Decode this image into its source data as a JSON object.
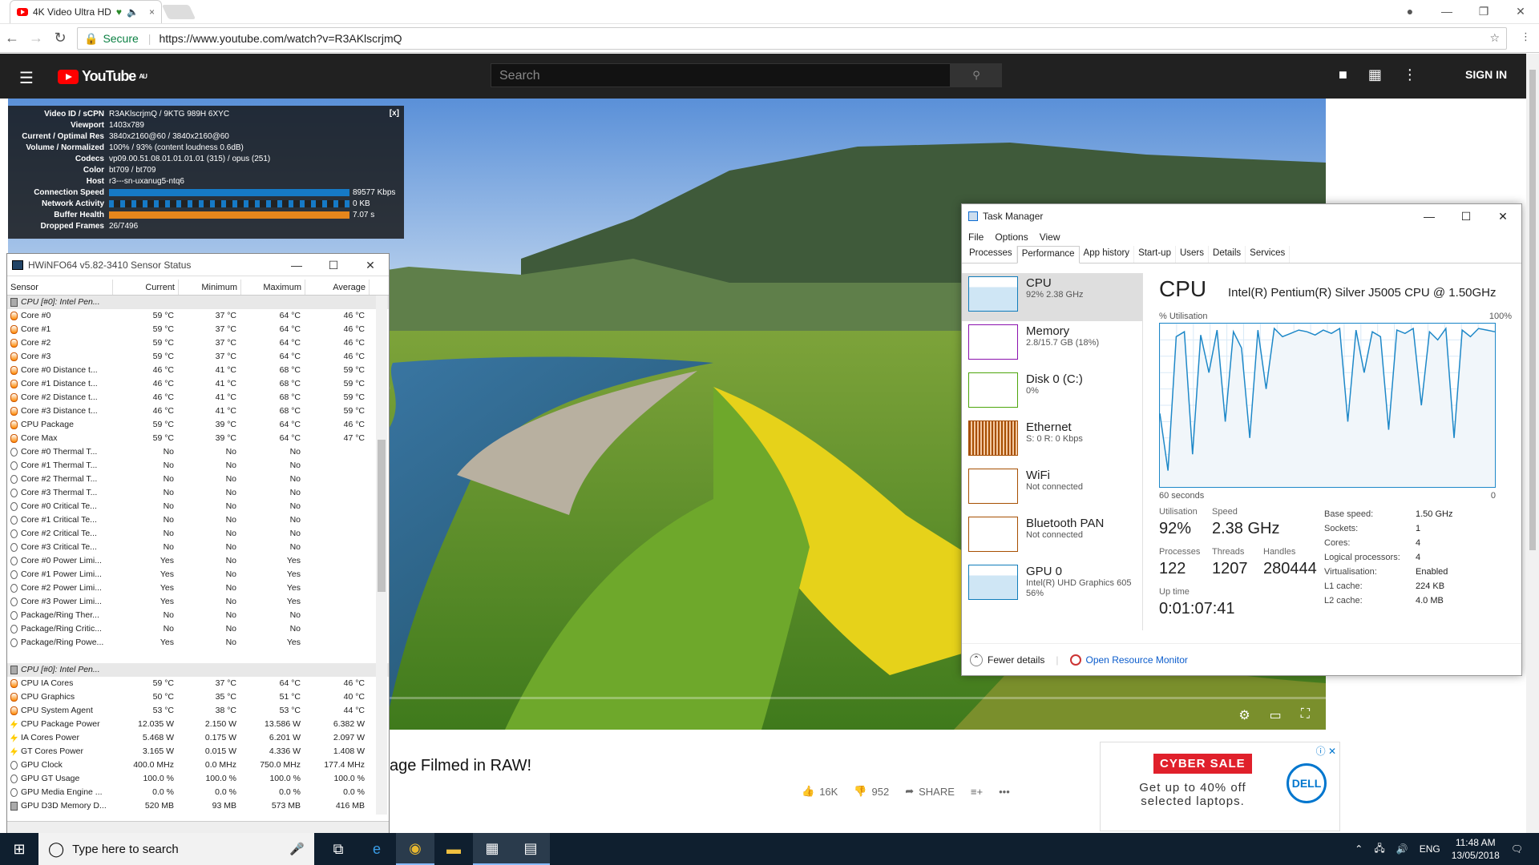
{
  "browser": {
    "tab_title": "4K Video Ultra HD",
    "secure_label": "Secure",
    "url": "https://www.youtube.com/watch?v=R3AKlscrjmQ"
  },
  "youtube": {
    "logo_text": "YouTube",
    "region": "AU",
    "search_placeholder": "Search",
    "signin": "SIGN IN",
    "title_fragment": "age Filmed in RAW!",
    "likes": "16K",
    "dislikes": "952",
    "share": "SHARE"
  },
  "stats": {
    "close": "[x]",
    "rows": [
      {
        "k": "Video ID / sCPN",
        "v": "R3AKlscrjmQ / 9KTG 989H 6XYC"
      },
      {
        "k": "Viewport",
        "v": "1403x789"
      },
      {
        "k": "Current / Optimal Res",
        "v": "3840x2160@60 / 3840x2160@60"
      },
      {
        "k": "Volume / Normalized",
        "v": "100% / 93% (content loudness 0.6dB)"
      },
      {
        "k": "Codecs",
        "v": "vp09.00.51.08.01.01.01.01 (315) / opus (251)"
      },
      {
        "k": "Color",
        "v": "bt709 / bt709"
      },
      {
        "k": "Host",
        "v": "r3---sn-uxanug5-ntq6"
      }
    ],
    "bars": [
      {
        "k": "Connection Speed",
        "v": "89577 Kbps",
        "cls": "bar1"
      },
      {
        "k": "Network Activity",
        "v": "0 KB",
        "cls": "bar2"
      },
      {
        "k": "Buffer Health",
        "v": "7.07 s",
        "cls": "bar3"
      }
    ],
    "dropped": {
      "k": "Dropped Frames",
      "v": "26/7496"
    }
  },
  "ad": {
    "headline": "CYBER SALE",
    "body": "Get up to 40% off selected laptops.",
    "brand": "DELL"
  },
  "hwinfo": {
    "title": "HWiNFO64 v5.82-3410 Sensor Status",
    "headers": [
      "Sensor",
      "Current",
      "Minimum",
      "Maximum",
      "Average"
    ],
    "rows": [
      [
        "grp",
        "CPU [#0]: Intel Pen...",
        "",
        "",
        "",
        ""
      ],
      [
        "th",
        "Core #0",
        "59 °C",
        "37 °C",
        "64 °C",
        "46 °C"
      ],
      [
        "th",
        "Core #1",
        "59 °C",
        "37 °C",
        "64 °C",
        "46 °C"
      ],
      [
        "th",
        "Core #2",
        "59 °C",
        "37 °C",
        "64 °C",
        "46 °C"
      ],
      [
        "th",
        "Core #3",
        "59 °C",
        "37 °C",
        "64 °C",
        "46 °C"
      ],
      [
        "th",
        "Core #0 Distance t...",
        "46 °C",
        "41 °C",
        "68 °C",
        "59 °C"
      ],
      [
        "th",
        "Core #1 Distance t...",
        "46 °C",
        "41 °C",
        "68 °C",
        "59 °C"
      ],
      [
        "th",
        "Core #2 Distance t...",
        "46 °C",
        "41 °C",
        "68 °C",
        "59 °C"
      ],
      [
        "th",
        "Core #3 Distance t...",
        "46 °C",
        "41 °C",
        "68 °C",
        "59 °C"
      ],
      [
        "th",
        "CPU Package",
        "59 °C",
        "39 °C",
        "64 °C",
        "46 °C"
      ],
      [
        "th",
        "Core Max",
        "59 °C",
        "39 °C",
        "64 °C",
        "47 °C"
      ],
      [
        "ck",
        "Core #0 Thermal T...",
        "No",
        "No",
        "No",
        ""
      ],
      [
        "ck",
        "Core #1 Thermal T...",
        "No",
        "No",
        "No",
        ""
      ],
      [
        "ck",
        "Core #2 Thermal T...",
        "No",
        "No",
        "No",
        ""
      ],
      [
        "ck",
        "Core #3 Thermal T...",
        "No",
        "No",
        "No",
        ""
      ],
      [
        "ck",
        "Core #0 Critical Te...",
        "No",
        "No",
        "No",
        ""
      ],
      [
        "ck",
        "Core #1 Critical Te...",
        "No",
        "No",
        "No",
        ""
      ],
      [
        "ck",
        "Core #2 Critical Te...",
        "No",
        "No",
        "No",
        ""
      ],
      [
        "ck",
        "Core #3 Critical Te...",
        "No",
        "No",
        "No",
        ""
      ],
      [
        "ck",
        "Core #0 Power Limi...",
        "Yes",
        "No",
        "Yes",
        ""
      ],
      [
        "ck",
        "Core #1 Power Limi...",
        "Yes",
        "No",
        "Yes",
        ""
      ],
      [
        "ck",
        "Core #2 Power Limi...",
        "Yes",
        "No",
        "Yes",
        ""
      ],
      [
        "ck",
        "Core #3 Power Limi...",
        "Yes",
        "No",
        "Yes",
        ""
      ],
      [
        "ck",
        "Package/Ring Ther...",
        "No",
        "No",
        "No",
        ""
      ],
      [
        "ck",
        "Package/Ring Critic...",
        "No",
        "No",
        "No",
        ""
      ],
      [
        "ck",
        "Package/Ring Powe...",
        "Yes",
        "No",
        "Yes",
        ""
      ],
      [
        "blank",
        "",
        "",
        "",
        "",
        ""
      ],
      [
        "grp",
        "CPU [#0]: Intel Pen...",
        "",
        "",
        "",
        ""
      ],
      [
        "th",
        "CPU IA Cores",
        "59 °C",
        "37 °C",
        "64 °C",
        "46 °C"
      ],
      [
        "th",
        "CPU Graphics",
        "50 °C",
        "35 °C",
        "51 °C",
        "40 °C"
      ],
      [
        "th",
        "CPU System Agent",
        "53 °C",
        "38 °C",
        "53 °C",
        "44 °C"
      ],
      [
        "pw",
        "CPU Package Power",
        "12.035 W",
        "2.150 W",
        "13.586 W",
        "6.382 W"
      ],
      [
        "pw",
        "IA Cores Power",
        "5.468 W",
        "0.175 W",
        "6.201 W",
        "2.097 W"
      ],
      [
        "pw",
        "GT Cores Power",
        "3.165 W",
        "0.015 W",
        "4.336 W",
        "1.408 W"
      ],
      [
        "ck",
        "GPU Clock",
        "400.0 MHz",
        "0.0 MHz",
        "750.0 MHz",
        "177.4 MHz"
      ],
      [
        "ck",
        "GPU GT Usage",
        "100.0 %",
        "100.0 %",
        "100.0 %",
        "100.0 %"
      ],
      [
        "ck",
        "GPU Media Engine ...",
        "0.0 %",
        "0.0 %",
        "0.0 %",
        "0.0 %"
      ],
      [
        "gp",
        "GPU D3D Memory D...",
        "520 MB",
        "93 MB",
        "573 MB",
        "416 MB"
      ]
    ]
  },
  "taskmgr": {
    "title": "Task Manager",
    "menu": [
      "File",
      "Options",
      "View"
    ],
    "tabs": [
      "Processes",
      "Performance",
      "App history",
      "Start-up",
      "Users",
      "Details",
      "Services"
    ],
    "resources": [
      {
        "name": "CPU",
        "sub1": "92% 2.38 GHz",
        "sub2": "",
        "color": "#117dbb"
      },
      {
        "name": "Memory",
        "sub1": "2.8/15.7 GB (18%)",
        "sub2": "",
        "color": "#8b12ae"
      },
      {
        "name": "Disk 0 (C:)",
        "sub1": "0%",
        "sub2": "",
        "color": "#4da60c"
      },
      {
        "name": "Ethernet",
        "sub1": "S: 0 R: 0 Kbps",
        "sub2": "",
        "color": "#a74f01"
      },
      {
        "name": "WiFi",
        "sub1": "Not connected",
        "sub2": "",
        "color": "#a74f01"
      },
      {
        "name": "Bluetooth PAN",
        "sub1": "Not connected",
        "sub2": "",
        "color": "#a74f01"
      },
      {
        "name": "GPU 0",
        "sub1": "Intel(R) UHD Graphics 605",
        "sub2": "56%",
        "color": "#117dbb"
      }
    ],
    "heading": "CPU",
    "cpu_name": "Intel(R) Pentium(R) Silver J5005 CPU @ 1.50GHz",
    "util_label": "% Utilisation",
    "pct100": "100%",
    "sixty": "60 seconds",
    "zero": "0",
    "utilisation_label": "Utilisation",
    "utilisation": "92%",
    "speed_label": "Speed",
    "speed": "2.38 GHz",
    "processes_label": "Processes",
    "processes": "122",
    "threads_label": "Threads",
    "threads": "1207",
    "handles_label": "Handles",
    "handles": "280444",
    "uptime_label": "Up time",
    "uptime": "0:01:07:41",
    "specs": [
      {
        "k": "Base speed:",
        "v": "1.50 GHz"
      },
      {
        "k": "Sockets:",
        "v": "1"
      },
      {
        "k": "Cores:",
        "v": "4"
      },
      {
        "k": "Logical processors:",
        "v": "4"
      },
      {
        "k": "Virtualisation:",
        "v": "Enabled"
      },
      {
        "k": "L1 cache:",
        "v": "224 KB"
      },
      {
        "k": "L2 cache:",
        "v": "4.0 MB"
      }
    ],
    "fewer": "Fewer details",
    "resmon": "Open Resource Monitor",
    "cpu_history": [
      45,
      10,
      92,
      95,
      20,
      93,
      70,
      96,
      40,
      95,
      85,
      30,
      96,
      60,
      97,
      92,
      94,
      96,
      95,
      93,
      96,
      94,
      97,
      40,
      96,
      70,
      95,
      92,
      35,
      96,
      94,
      97,
      50,
      95,
      90,
      97,
      30,
      96,
      92,
      97,
      96,
      95
    ]
  },
  "taskbar": {
    "search": "Type here to search",
    "lang": "ENG",
    "time": "11:48 AM",
    "date": "13/05/2018"
  }
}
